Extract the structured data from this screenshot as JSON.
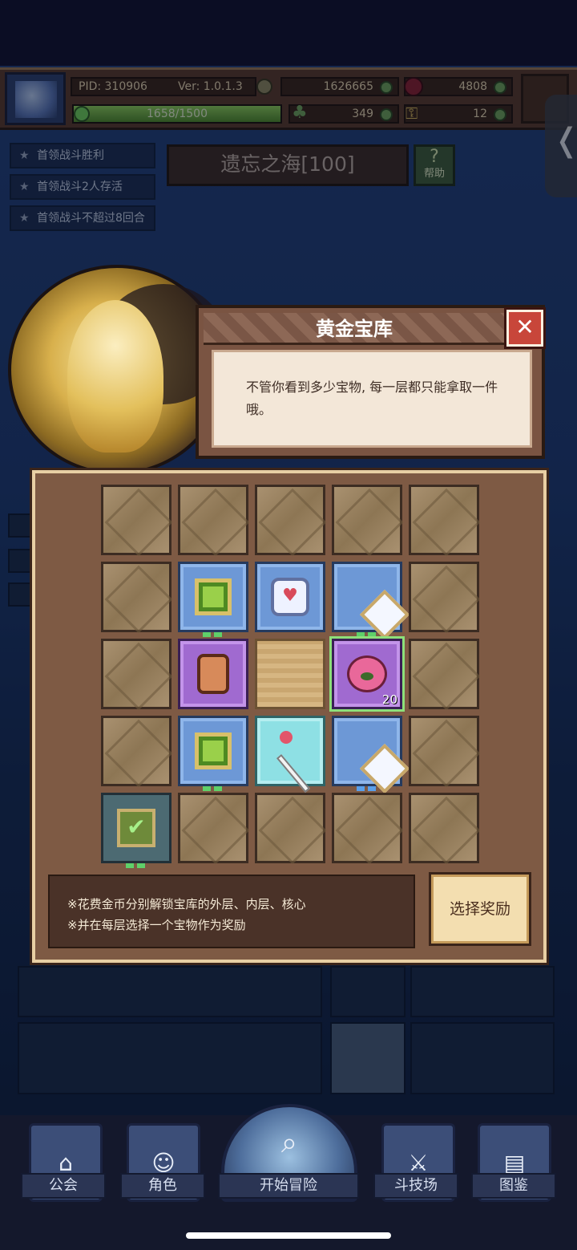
{
  "header": {
    "pid": "PID: 310906",
    "version": "Ver: 1.0.1.3",
    "gold": "1626665",
    "gems": "4808",
    "exp": "1658/1500",
    "exp_fraction": 1.0,
    "clovers": "349",
    "keys": "12"
  },
  "side_tab": {
    "glyph": "❬"
  },
  "quests": [
    {
      "label": "首领战斗胜利"
    },
    {
      "label": "首领战斗2人存活"
    },
    {
      "label": "首领战斗不超过8回合"
    }
  ],
  "stage": {
    "title": "遗忘之海[100]",
    "help_label": "帮助",
    "help_glyph": "?"
  },
  "dialog": {
    "title": "黄金宝库",
    "close_glyph": "✕",
    "message": "不管你看到多少宝物, 每一层都只能拿取一件哦。"
  },
  "vault": {
    "items": [
      {
        "id": "green-gem-top",
        "quantity": ""
      },
      {
        "id": "heart-box",
        "quantity": ""
      },
      {
        "id": "diamond-top",
        "quantity": ""
      },
      {
        "id": "scroll",
        "quantity": ""
      },
      {
        "id": "fruit",
        "quantity": "20"
      },
      {
        "id": "green-gem-bottom",
        "quantity": ""
      },
      {
        "id": "wand",
        "quantity": ""
      },
      {
        "id": "diamond-bottom",
        "quantity": ""
      }
    ],
    "check_glyph": "✔",
    "heart_glyph": "♥",
    "tips": [
      "※花费金币分别解锁宝库的外层、内层、核心",
      "※并在每层选择一个宝物作为奖励"
    ],
    "choose_button": "选择奖励"
  },
  "nav": {
    "guild": "公会",
    "role": "角色",
    "start": "开始冒险",
    "arena": "斗技场",
    "codex": "图鉴"
  },
  "icons": {
    "clover": "♣",
    "key": "⚿",
    "star": "★",
    "search": "⌕",
    "home": "⌂",
    "role": "☺",
    "arena": "⚔",
    "codex": "▤"
  }
}
